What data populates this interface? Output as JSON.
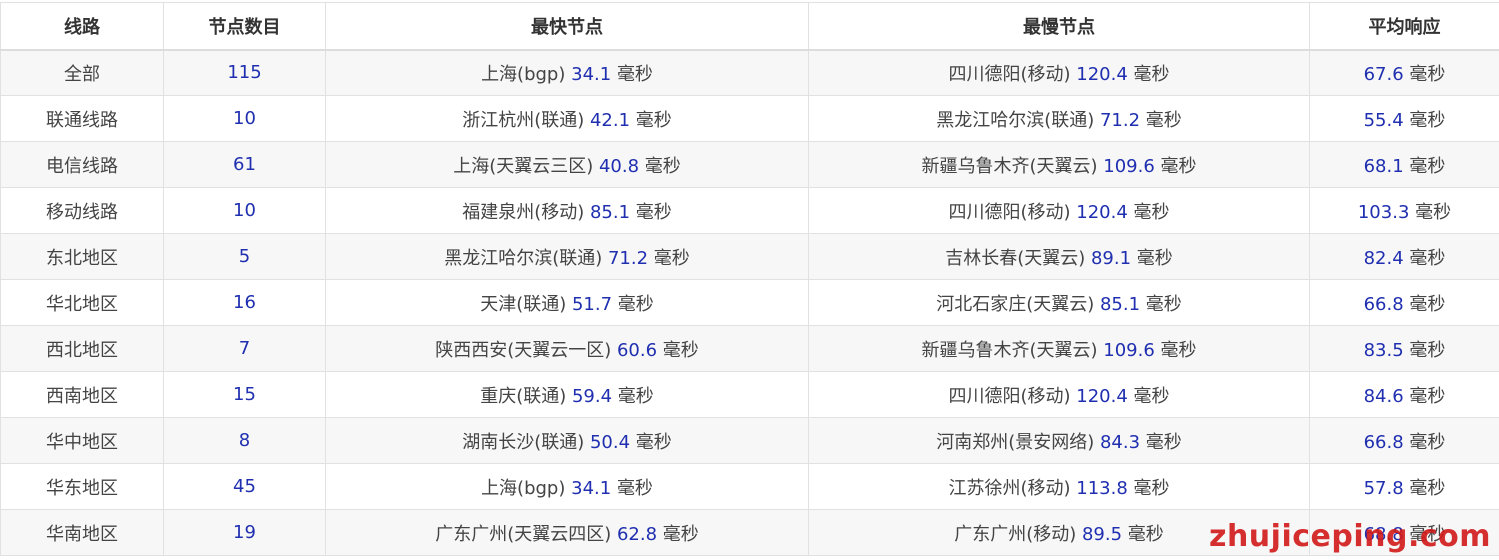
{
  "headers": {
    "route": "线路",
    "node_count": "节点数目",
    "fastest": "最快节点",
    "slowest": "最慢节点",
    "average": "平均响应"
  },
  "unit": "毫秒",
  "rows": [
    {
      "route": "全部",
      "count": "115",
      "fast_loc": "上海(bgp)",
      "fast_ms": "34.1",
      "slow_loc": "四川德阳(移动)",
      "slow_ms": "120.4",
      "avg_ms": "67.6"
    },
    {
      "route": "联通线路",
      "count": "10",
      "fast_loc": "浙江杭州(联通)",
      "fast_ms": "42.1",
      "slow_loc": "黑龙江哈尔滨(联通)",
      "slow_ms": "71.2",
      "avg_ms": "55.4"
    },
    {
      "route": "电信线路",
      "count": "61",
      "fast_loc": "上海(天翼云三区)",
      "fast_ms": "40.8",
      "slow_loc": "新疆乌鲁木齐(天翼云)",
      "slow_ms": "109.6",
      "avg_ms": "68.1"
    },
    {
      "route": "移动线路",
      "count": "10",
      "fast_loc": "福建泉州(移动)",
      "fast_ms": "85.1",
      "slow_loc": "四川德阳(移动)",
      "slow_ms": "120.4",
      "avg_ms": "103.3"
    },
    {
      "route": "东北地区",
      "count": "5",
      "fast_loc": "黑龙江哈尔滨(联通)",
      "fast_ms": "71.2",
      "slow_loc": "吉林长春(天翼云)",
      "slow_ms": "89.1",
      "avg_ms": "82.4"
    },
    {
      "route": "华北地区",
      "count": "16",
      "fast_loc": "天津(联通)",
      "fast_ms": "51.7",
      "slow_loc": "河北石家庄(天翼云)",
      "slow_ms": "85.1",
      "avg_ms": "66.8"
    },
    {
      "route": "西北地区",
      "count": "7",
      "fast_loc": "陕西西安(天翼云一区)",
      "fast_ms": "60.6",
      "slow_loc": "新疆乌鲁木齐(天翼云)",
      "slow_ms": "109.6",
      "avg_ms": "83.5"
    },
    {
      "route": "西南地区",
      "count": "15",
      "fast_loc": "重庆(联通)",
      "fast_ms": "59.4",
      "slow_loc": "四川德阳(移动)",
      "slow_ms": "120.4",
      "avg_ms": "84.6"
    },
    {
      "route": "华中地区",
      "count": "8",
      "fast_loc": "湖南长沙(联通)",
      "fast_ms": "50.4",
      "slow_loc": "河南郑州(景安网络)",
      "slow_ms": "84.3",
      "avg_ms": "66.8"
    },
    {
      "route": "华东地区",
      "count": "45",
      "fast_loc": "上海(bgp)",
      "fast_ms": "34.1",
      "slow_loc": "江苏徐州(移动)",
      "slow_ms": "113.8",
      "avg_ms": "57.8"
    },
    {
      "route": "华南地区",
      "count": "19",
      "fast_loc": "广东广州(天翼云四区)",
      "fast_ms": "62.8",
      "slow_loc": "广东广州(移动)",
      "slow_ms": "89.5",
      "avg_ms": "68.8"
    }
  ],
  "watermark": "zhujiceping.com",
  "colors": {
    "number": "#1f2fb0",
    "text": "#444444",
    "watermark": "#d21919"
  }
}
